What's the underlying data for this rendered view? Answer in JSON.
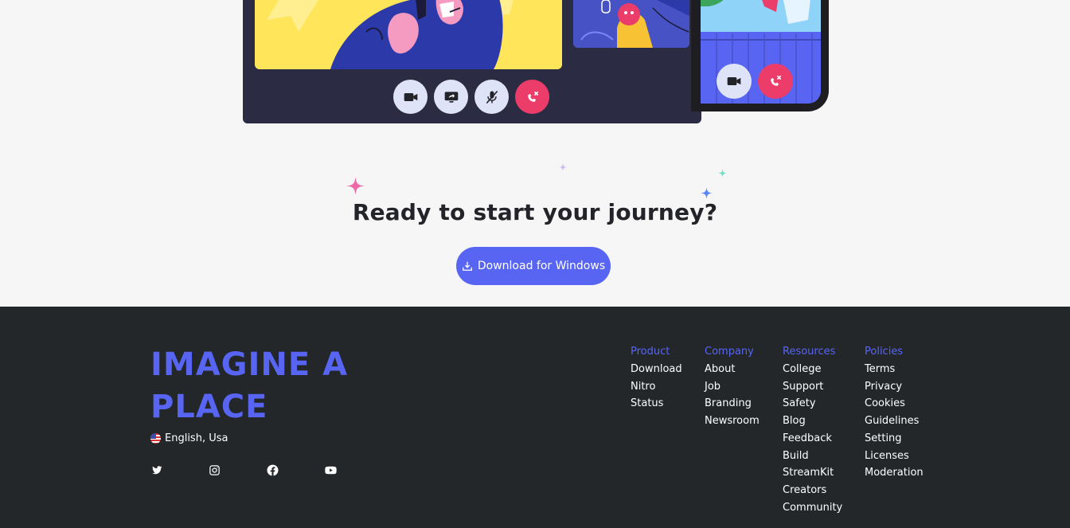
{
  "controls": {
    "video": "video-camera-icon",
    "screen_share": "screen-share-icon",
    "mute": "microphone-muted-icon",
    "hangup": "hang-up-icon"
  },
  "cta": {
    "title": "Ready to start your journey?",
    "download_label": "Download for Windows"
  },
  "footer": {
    "brand": "IMAGINE A PLACE",
    "language": "English, Usa",
    "socials": [
      "twitter-icon",
      "instagram-icon",
      "facebook-icon",
      "youtube-icon"
    ],
    "columns": [
      {
        "heading": "Product",
        "links": [
          "Download",
          "Nitro",
          "Status"
        ]
      },
      {
        "heading": "Company",
        "links": [
          "About",
          "Job",
          "Branding",
          "Newsroom"
        ]
      },
      {
        "heading": "Resources",
        "links": [
          "College",
          "Support",
          "Safety",
          "Blog",
          "Feedback",
          "Build",
          "StreamKit",
          "Creators",
          "Community"
        ]
      },
      {
        "heading": "Policies",
        "links": [
          "Terms",
          "Privacy",
          "Cookies",
          "Guidelines",
          "Setting",
          "Licenses",
          "Moderation"
        ]
      }
    ]
  },
  "colors": {
    "accent": "#5865f2",
    "hangup": "#ec3c6a",
    "footer_bg": "#23272a",
    "page_bg": "#f6f6f6"
  }
}
